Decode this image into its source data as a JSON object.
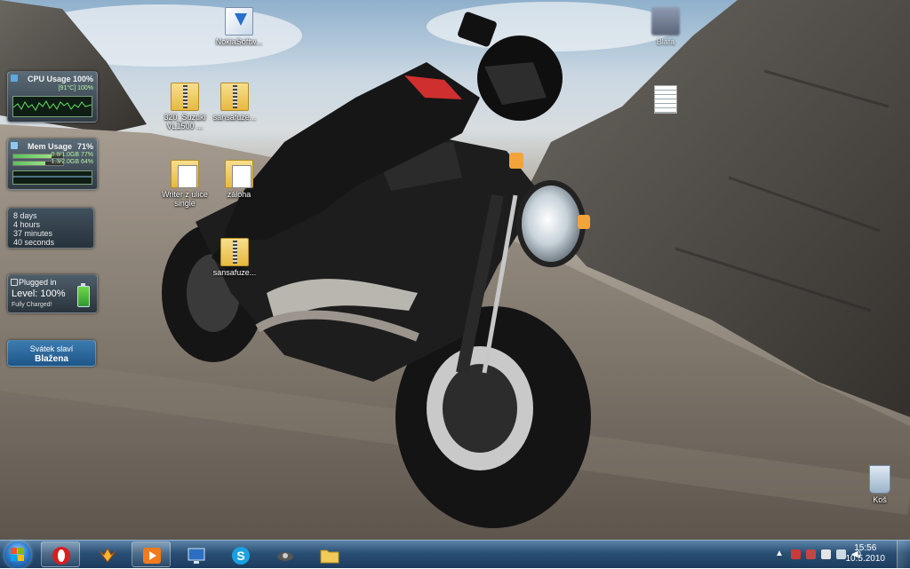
{
  "gadgets": {
    "cpu": {
      "title": "CPU Usage",
      "percent": "100%",
      "detail": "[91°C]  100%"
    },
    "memory": {
      "title": "Mem Usage",
      "percent": "71%",
      "line1": "0.8/1.0GB  77%",
      "line2": "1.3/2.0GB  64%"
    },
    "uptime": {
      "days": "8 days",
      "hours": "4 hours",
      "minutes": "37 minutes",
      "seconds": "40 seconds"
    },
    "battery": {
      "status": "Plugged in",
      "level": "Level: 100%",
      "note": "Fully Charged!",
      "level_value": 1.0
    },
    "nameday": {
      "line1": "Svátek slaví",
      "name": "Blažena"
    }
  },
  "desktop_icons": {
    "nokia": {
      "label": "NokiaSoftw...",
      "icon": "installer-icon"
    },
    "blurred": {
      "label": "Blafa",
      "icon": "blurred-icon"
    },
    "suzuki": {
      "label": "320_Suzuki VL1500 ...",
      "icon": "zip-folder-icon"
    },
    "sansafuze1": {
      "label": "sansafuze...",
      "icon": "zip-folder-icon"
    },
    "textfile": {
      "label": "",
      "icon": "text-document-icon"
    },
    "writer": {
      "label": "Writer z ulice single",
      "icon": "folder-icon"
    },
    "zaloha": {
      "label": "záloha",
      "icon": "folder-icon"
    },
    "sansafuze2": {
      "label": "sansafuze...",
      "icon": "zip-folder-icon"
    },
    "recycle": {
      "label": "Koš",
      "icon": "recycle-bin-icon"
    }
  },
  "taskbar": {
    "pinned": [
      {
        "name": "opera",
        "icon": "opera-icon",
        "active": true
      },
      {
        "name": "winamp",
        "icon": "winamp-icon",
        "active": false
      },
      {
        "name": "media-player",
        "icon": "media-player-icon",
        "active": true
      },
      {
        "name": "remote",
        "icon": "monitor-icon",
        "active": false
      },
      {
        "name": "skype",
        "icon": "skype-icon",
        "active": false
      },
      {
        "name": "driver",
        "icon": "device-icon",
        "active": false
      },
      {
        "name": "explorer",
        "icon": "folder-icon",
        "active": false
      }
    ],
    "clock": {
      "time": "15:56",
      "date": "10.5.2010"
    }
  },
  "colors": {
    "taskbar": "#2a4f74",
    "accent": "#2f7fd1",
    "opera": "#d81e1e",
    "skype": "#1aa1e1"
  }
}
